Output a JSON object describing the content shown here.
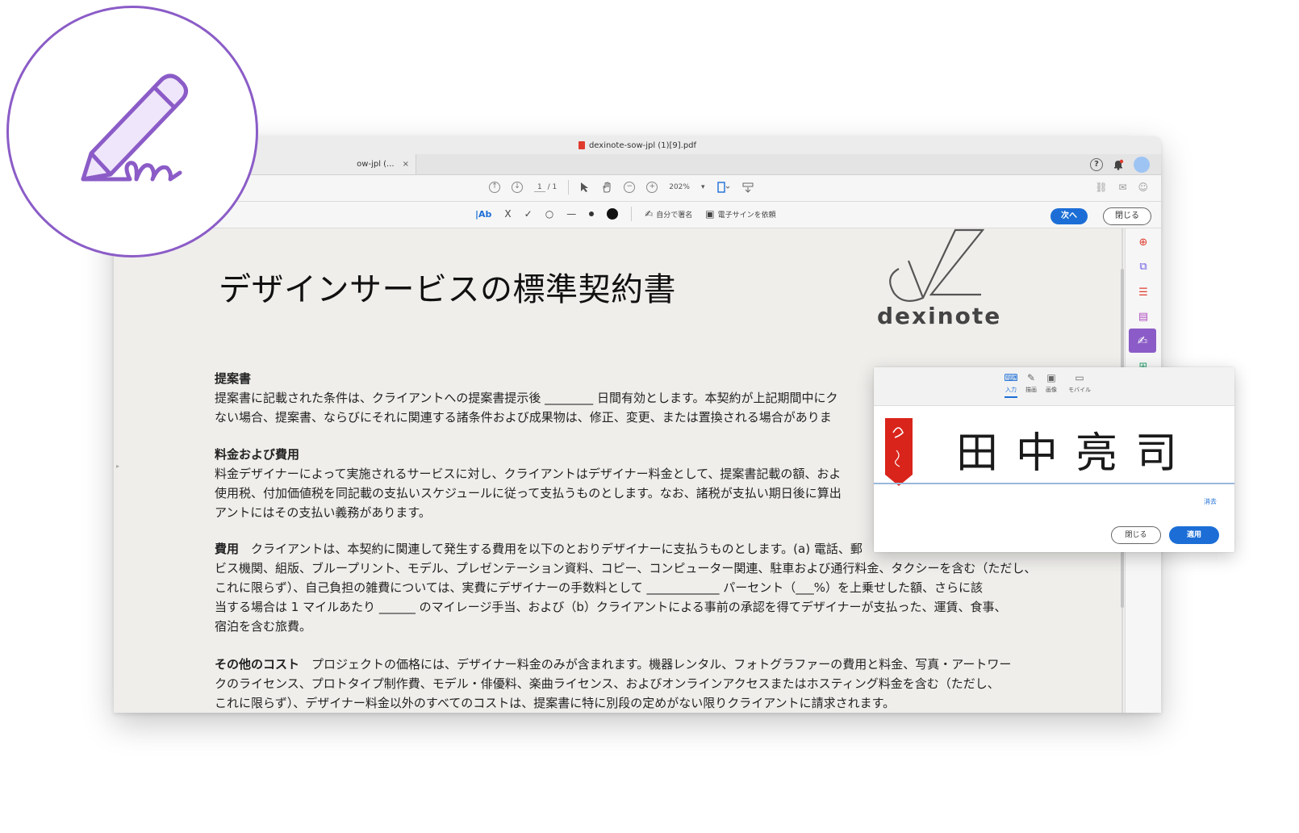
{
  "window": {
    "title": "dexinote-sow-jpl (1)[9].pdf",
    "tab_label": "ow-jpl (...",
    "tab_close": "×"
  },
  "toolbar": {
    "page_current": "1",
    "page_separator": "/ 1",
    "zoom": "202%",
    "tools_icons": [
      "text-field-icon",
      "cross-icon",
      "check-icon",
      "ellipse-icon",
      "line-icon",
      "dot-icon",
      "filled-dot-icon"
    ],
    "text_tool_label": "|Ab",
    "cross_label": "X",
    "check_label": "✓",
    "ellipse_label": "○",
    "line_label": "—",
    "self_sign_label": "自分で署名",
    "request_esign_label": "電子サインを依頼",
    "next_label": "次へ",
    "close_label": "閉じる"
  },
  "document": {
    "title": "デザインサービスの標準契約書",
    "logo_text": "dexinote",
    "section1_heading": "提案書",
    "section1_line1": "提案書に記載された条件は、クライアントへの提案書提示後 ________ 日間有効とします。本契約が上記期間中にク",
    "section1_line2": "ない場合、提案書、ならびにそれに関連する諸条件および成果物は、修正、変更、または置換される場合がありま",
    "section2_heading": "料金および費用",
    "section2_line1": "料金デザイナーによって実施されるサービスに対し、クライアントはデザイナー料金として、提案書記載の額、およ",
    "section2_line2": "使用税、付加価値税を同記載の支払いスケジュールに従って支払うものとします。なお、諸税が支払い期日後に算出",
    "section2_line3": "アントにはその支払い義務があります。",
    "section3_heading": "費用",
    "section3_line1": "クライアントは、本契約に関連して発生する費用を以下のとおりデザイナーに支払うものとします。(a) 電話、郵",
    "section3_line2": "ビス機関、組版、ブループリント、モデル、プレゼンテーション資料、コピー、コンピューター関連、駐車および通行料金、タクシーを含む（ただし、",
    "section3_line3": "これに限らず）、自己負担の雑費については、実費にデザイナーの手数料として ____________ パーセント（___%）を上乗せした額、さらに該",
    "section3_line4": "当する場合は 1 マイルあたり ______ のマイレージ手当、および（b）クライアントによる事前の承認を得てデザイナーが支払った、運賃、食事、",
    "section3_line5": "宿泊を含む旅費。",
    "section4_heading": "その他のコスト",
    "section4_line1": "プロジェクトの価格には、デザイナー料金のみが含まれます。機器レンタル、フォトグラファーの費用と料金、写真・アートワー",
    "section4_line2": "クのライセンス、プロトタイプ制作費、モデル・俳優料、楽曲ライセンス、およびオンラインアクセスまたはホスティング料金を含む（ただし、",
    "section4_line3": "これに限らず）、デザイナー料金以外のすべてのコストは、提案書に特に別段の定めがない限りクライアントに請求されます。"
  },
  "signature_panel": {
    "tabs": [
      {
        "label": "入力",
        "icon": "keyboard-icon",
        "active": true
      },
      {
        "label": "描画",
        "icon": "pen-icon",
        "active": false
      },
      {
        "label": "画像",
        "icon": "image-icon",
        "active": false
      },
      {
        "label": "モバイル",
        "icon": "mobile-icon",
        "active": false
      }
    ],
    "signature_text": "田中亮司",
    "clear_label": "消去",
    "close_label": "閉じる",
    "apply_label": "適用"
  },
  "colors": {
    "accent_purple": "#8b5cc7",
    "primary_blue": "#1c6ed6",
    "acrobat_red": "#e03a2e"
  }
}
